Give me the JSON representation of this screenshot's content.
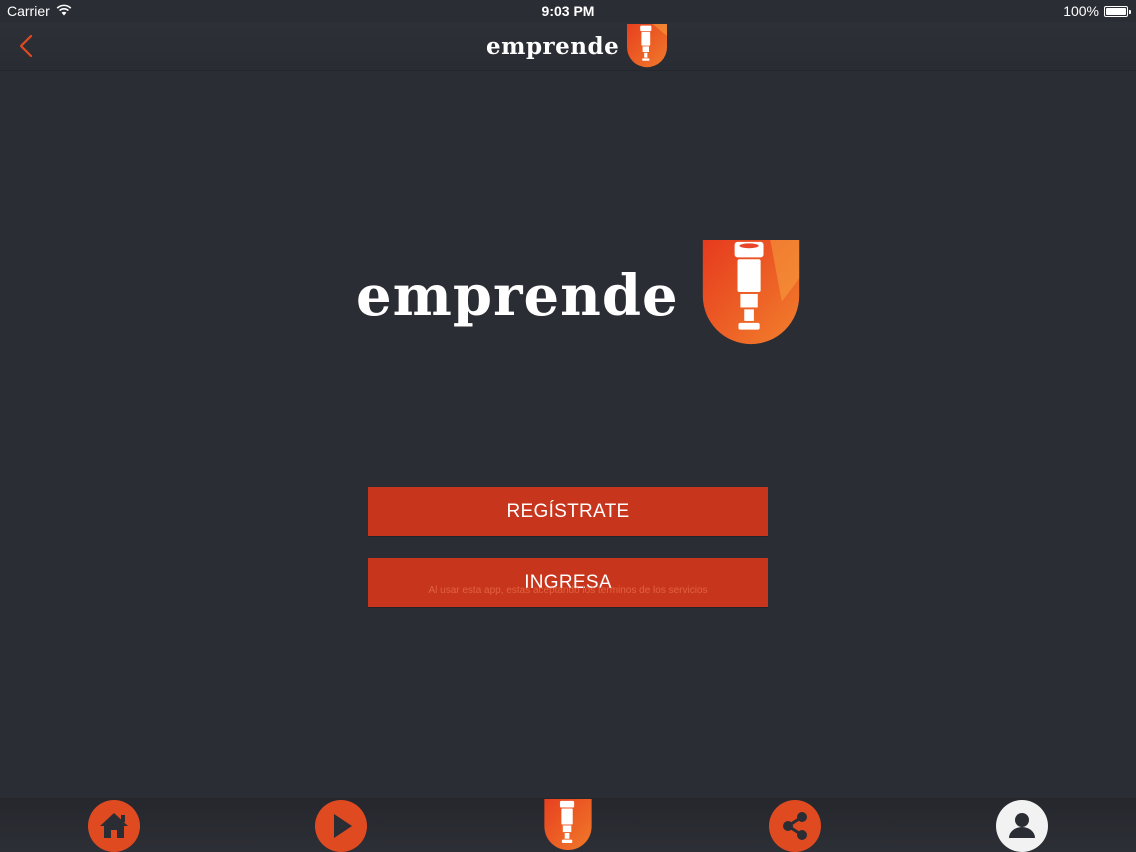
{
  "status_bar": {
    "carrier": "Carrier",
    "time": "9:03 PM",
    "battery": "100%",
    "battery_level": 1.0
  },
  "nav": {
    "back_icon": "chevron-left-icon",
    "brand": "emprende"
  },
  "hero": {
    "brand": "emprende"
  },
  "actions": {
    "register_label": "REGÍSTRATE",
    "login_label": "INGRESA",
    "terms_text": "Al usar esta app, estas aceptando los terminos de los servicios"
  },
  "tab_bar": {
    "items": [
      {
        "icon": "home-icon"
      },
      {
        "icon": "play-icon"
      },
      {
        "icon": "emprende-logo-icon"
      },
      {
        "icon": "share-icon"
      },
      {
        "icon": "user-icon"
      }
    ]
  },
  "colors": {
    "background": "#2b2d35",
    "accent": "#e04a21",
    "button": "#c7361c"
  }
}
